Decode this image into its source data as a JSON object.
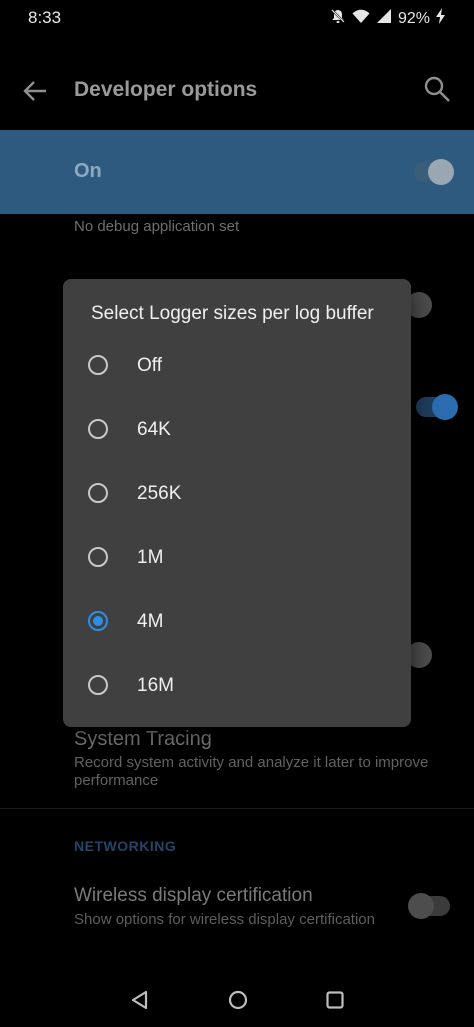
{
  "status_bar": {
    "time": "8:33",
    "battery": "92%",
    "icons": [
      "notifications-off-icon",
      "wifi-icon",
      "signal-icon",
      "charging-icon"
    ]
  },
  "app_bar": {
    "title": "Developer options",
    "back_icon": "back-arrow-icon",
    "search_icon": "search-icon"
  },
  "master_toggle": {
    "label": "On",
    "state": true
  },
  "background_rows": {
    "debug_app_subtitle": "No debug application set",
    "system_tracing": {
      "title": "System Tracing",
      "subtitle": "Record system activity and analyze it later to improve performance"
    },
    "networking_header": "NETWORKING",
    "wireless_display": {
      "title": "Wireless display certification",
      "subtitle": "Show options for wireless display certification",
      "state": false
    }
  },
  "dialog": {
    "title": "Select Logger sizes per log buffer",
    "options": [
      {
        "label": "Off",
        "selected": false
      },
      {
        "label": "64K",
        "selected": false
      },
      {
        "label": "256K",
        "selected": false
      },
      {
        "label": "1M",
        "selected": false
      },
      {
        "label": "4M",
        "selected": true
      },
      {
        "label": "16M",
        "selected": false
      }
    ]
  },
  "nav_bar": {
    "icons": [
      "nav-back-icon",
      "nav-home-icon",
      "nav-recents-icon"
    ]
  },
  "colors": {
    "accent": "#2f8de4",
    "toggle_strip": "#2e5a7f",
    "dialog_bg": "#404040"
  }
}
